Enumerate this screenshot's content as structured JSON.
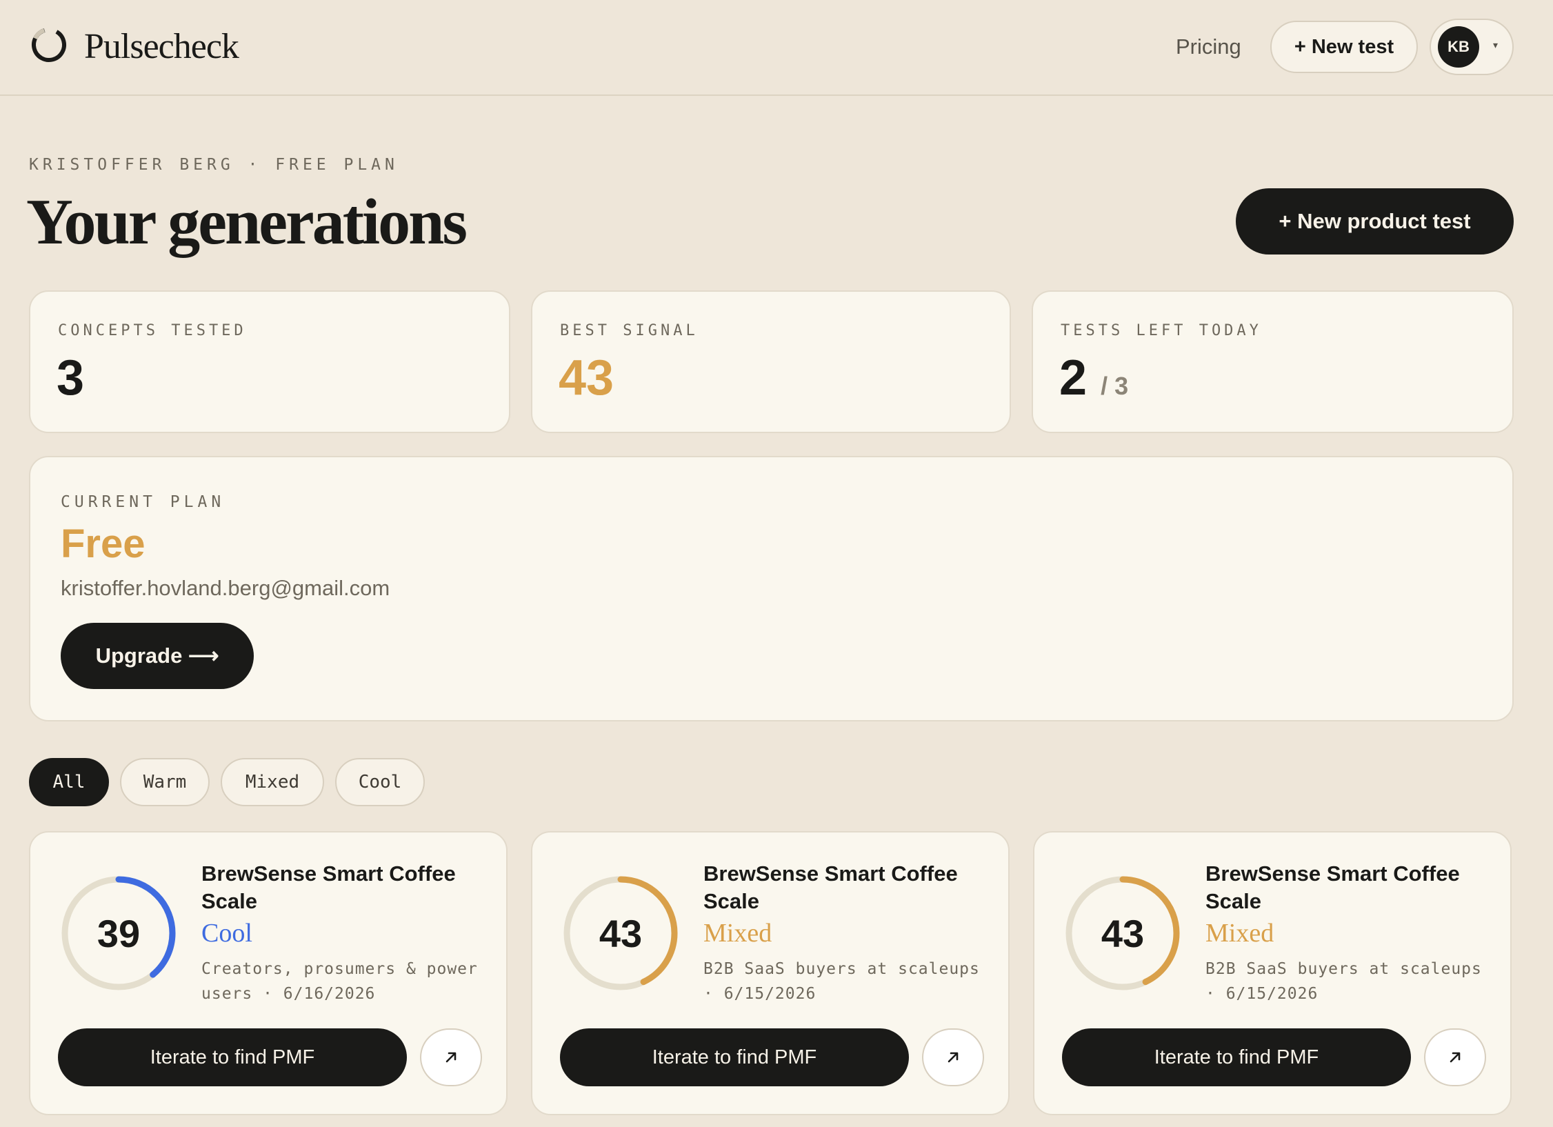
{
  "app": {
    "name": "Pulsecheck"
  },
  "header": {
    "pricing_label": "Pricing",
    "new_test_label": "+ New test",
    "avatar_initials": "KB",
    "caret": "▾"
  },
  "page": {
    "eyebrow": "KRISTOFFER BERG · FREE PLAN",
    "title": "Your generations",
    "new_product_test_label": "+ New product test"
  },
  "stats": {
    "concepts_label": "CONCEPTS TESTED",
    "concepts_value": "3",
    "best_label": "BEST SIGNAL",
    "best_value": "43",
    "tests_left_label": "TESTS LEFT TODAY",
    "tests_left_value": "2",
    "tests_left_total": "/ 3"
  },
  "plan": {
    "label": "CURRENT PLAN",
    "name": "Free",
    "email": "kristoffer.hovland.berg@gmail.com",
    "upgrade_label": "Upgrade ⟶"
  },
  "filters": [
    "All",
    "Warm",
    "Mixed",
    "Cool"
  ],
  "active_filter": "All",
  "results": [
    {
      "score": "39",
      "score_fraction": 0.39,
      "title": "BrewSense Smart Coffee Scale",
      "signal": "Cool",
      "signal_color": "#3E6BE0",
      "meta": "Creators, prosumers & power users · 6/16/2026",
      "iterate_label": "Iterate to find PMF",
      "open_icon": "arrow-up-right-icon"
    },
    {
      "score": "43",
      "score_fraction": 0.43,
      "title": "BrewSense Smart Coffee Scale",
      "signal": "Mixed",
      "signal_color": "#D9A04A",
      "meta": "B2B SaaS buyers at scaleups · 6/15/2026",
      "iterate_label": "Iterate to find PMF",
      "open_icon": "arrow-up-right-icon"
    },
    {
      "score": "43",
      "score_fraction": 0.43,
      "title": "BrewSense Smart Coffee Scale",
      "signal": "Mixed",
      "signal_color": "#D9A04A",
      "meta": "B2B SaaS buyers at scaleups · 6/15/2026",
      "iterate_label": "Iterate to find PMF",
      "open_icon": "arrow-up-right-icon"
    }
  ],
  "colors": {
    "background": "#EEE6D9",
    "card": "#FAF7EE",
    "ink": "#1A1A18",
    "accent": "#D9A04A",
    "cool": "#3E6BE0",
    "ring_track": "#E4DECD"
  }
}
